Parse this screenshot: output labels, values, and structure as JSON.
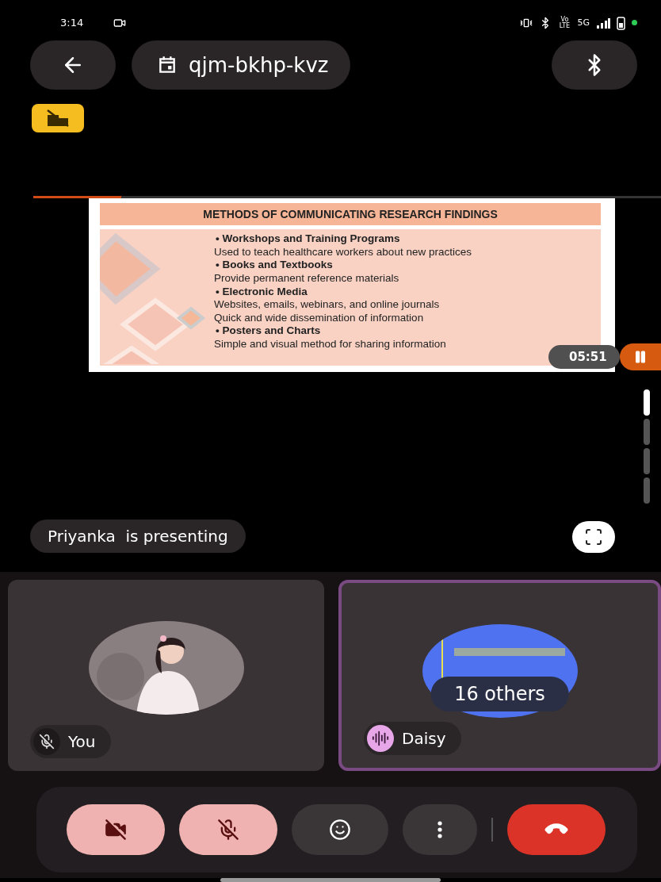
{
  "status_bar": {
    "time": "3:14",
    "volte": "Vo LTE",
    "network": "5G"
  },
  "top_bar": {
    "meeting_code": "qjm-bkhp-kvz"
  },
  "presentation": {
    "progress": {
      "level": 0.14
    },
    "slide": {
      "title": "METHODS OF COMMUNICATING RESEARCH FINDINGS",
      "lines": [
        {
          "kind": "heading",
          "text": "• Workshops and Training Programs"
        },
        {
          "kind": "body",
          "text": "Used to teach healthcare workers about new practices"
        },
        {
          "kind": "heading",
          "text": "• Books and Textbooks"
        },
        {
          "kind": "body",
          "text": "Provide permanent reference materials"
        },
        {
          "kind": "heading",
          "text": "• Electronic Media"
        },
        {
          "kind": "body",
          "text": "Websites, emails, webinars, and online journals"
        },
        {
          "kind": "body",
          "text": "Quick and wide dissemination of information"
        },
        {
          "kind": "heading",
          "text": "• Posters and Charts"
        },
        {
          "kind": "body",
          "text": "Simple and visual method for sharing information"
        }
      ]
    },
    "timer": "05:51",
    "presenter_label": "Priyanka  is presenting"
  },
  "tiles": [
    {
      "name": "You",
      "muted": true,
      "speaking": false
    },
    {
      "name": "Daisy",
      "muted": false,
      "speaking": true,
      "overlay": "16 others"
    }
  ],
  "controls": [
    {
      "kind": "camera",
      "on": false
    },
    {
      "kind": "mic",
      "on": false
    },
    {
      "kind": "reactions"
    },
    {
      "kind": "more"
    },
    {
      "kind": "hangup"
    }
  ]
}
